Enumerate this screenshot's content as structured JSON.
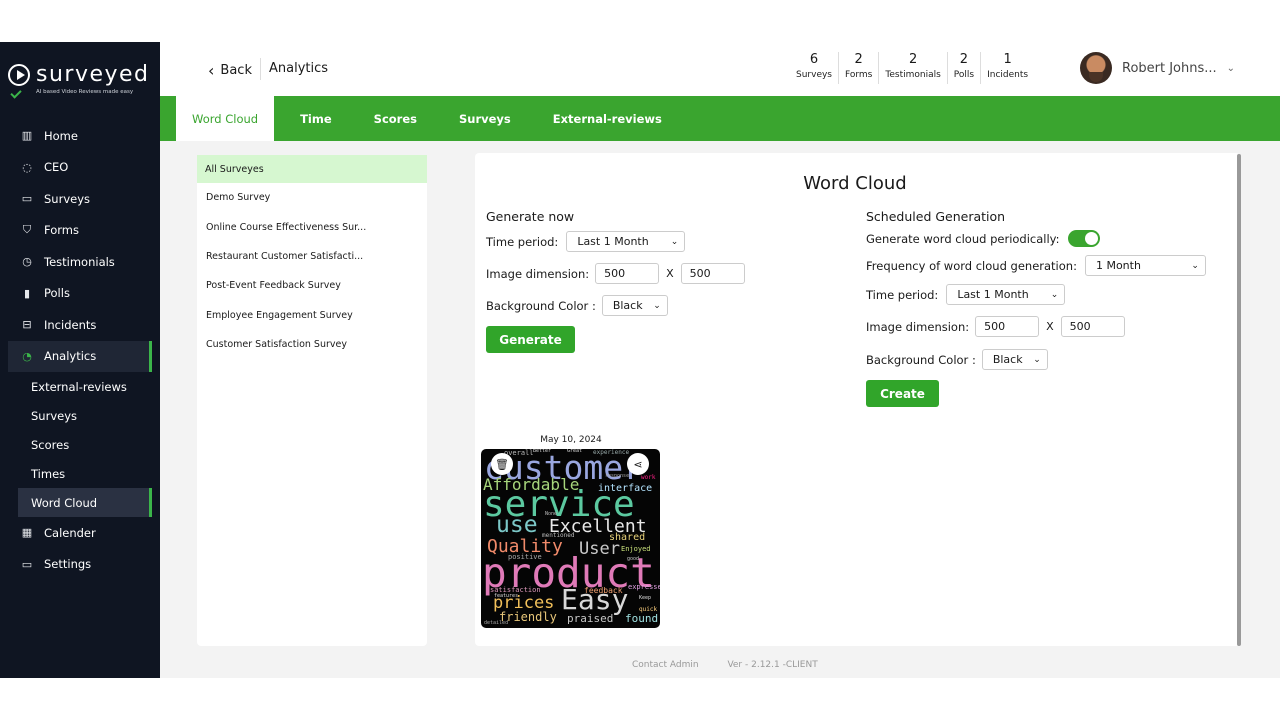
{
  "brand": {
    "name": "surveyed",
    "tagline": "AI based Video Reviews made easy"
  },
  "sidebar": {
    "items": [
      {
        "label": "Home",
        "icon": "building-icon"
      },
      {
        "label": "CEO",
        "icon": "ring-icon"
      },
      {
        "label": "Surveys",
        "icon": "window-icon"
      },
      {
        "label": "Forms",
        "icon": "shield-check-icon"
      },
      {
        "label": "Testimonials",
        "icon": "clock-icon"
      },
      {
        "label": "Polls",
        "icon": "bar-chart-icon"
      },
      {
        "label": "Incidents",
        "icon": "incident-icon"
      },
      {
        "label": "Analytics",
        "icon": "pie-icon"
      }
    ],
    "sub_items": [
      "External-reviews",
      "Surveys",
      "Scores",
      "Times",
      "Word Cloud"
    ],
    "bottom_items": [
      {
        "label": "Calender",
        "icon": "calendar-icon"
      },
      {
        "label": "Settings",
        "icon": "window-icon"
      }
    ]
  },
  "header": {
    "back_label": "Back",
    "title": "Analytics",
    "stats": [
      {
        "value": "6",
        "label": "Surveys"
      },
      {
        "value": "2",
        "label": "Forms"
      },
      {
        "value": "2",
        "label": "Testimonials"
      },
      {
        "value": "2",
        "label": "Polls"
      },
      {
        "value": "1",
        "label": "Incidents"
      }
    ],
    "user_name": "Robert Johns..."
  },
  "tabs": [
    "Word Cloud",
    "Time",
    "Scores",
    "Surveys",
    "External-reviews"
  ],
  "surveys_panel": {
    "all_label": "All Surveyes",
    "items": [
      "Demo Survey",
      "Online Course Effectiveness Sur...",
      "Restaurant Customer Satisfacti...",
      "Post-Event Feedback Survey",
      "Employee Engagement Survey",
      "Customer Satisfaction Survey"
    ]
  },
  "word_cloud": {
    "title": "Word Cloud",
    "generate_now": {
      "heading": "Generate now",
      "time_period_label": "Time period:",
      "time_period_value": "Last 1 Month",
      "dimension_label": "Image dimension:",
      "width": "500",
      "x": "X",
      "height": "500",
      "bg_label": "Background Color :",
      "bg_value": "Black",
      "button": "Generate"
    },
    "scheduled": {
      "heading": "Scheduled Generation",
      "periodic_label": "Generate word cloud periodically:",
      "periodic_on": true,
      "frequency_label": "Frequency of word cloud generation:",
      "frequency_value": "1 Month",
      "time_period_label": "Time period:",
      "time_period_value": "Last 1 Month",
      "dimension_label": "Image dimension:",
      "width": "500",
      "x": "X",
      "height": "500",
      "bg_label": "Background Color :",
      "bg_value": "Black",
      "button": "Create"
    },
    "result": {
      "date": "May 10, 2024",
      "words": [
        "customer",
        "service",
        "product",
        "Affordable",
        "use",
        "Excellent",
        "Quality",
        "User",
        "Easy",
        "prices",
        "friendly",
        "praised",
        "found",
        "interface",
        "overall",
        "Better",
        "Great",
        "experience",
        "response",
        "work",
        "shared",
        "Enjoyed",
        "positive",
        "mentioned",
        "satisfaction",
        "feedback",
        "features",
        "expressed",
        "quick",
        "Keep",
        "detailed",
        "None",
        "good"
      ]
    }
  },
  "footer": {
    "contact": "Contact Admin",
    "version": "Ver - 2.12.1 -CLIENT"
  },
  "colors": {
    "accent": "#3aa52f",
    "sidebar_bg": "#0f1522",
    "selected_row": "#d6f7d0"
  }
}
